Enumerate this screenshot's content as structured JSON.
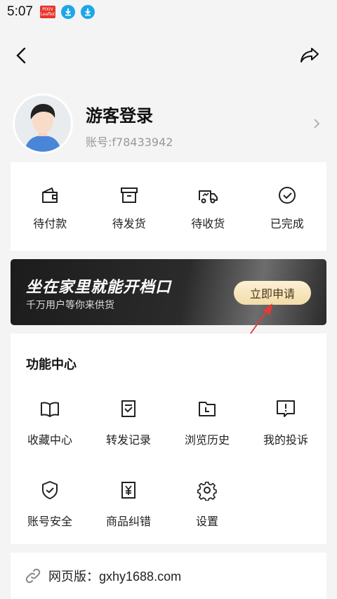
{
  "status_bar": {
    "time": "5:07",
    "badge_line1": "PIXIV",
    "badge_line2": "Leaflet"
  },
  "icons": {
    "back": "chevron-left-icon",
    "share": "share-icon"
  },
  "profile": {
    "name": "游客登录",
    "account": "账号:f78433942"
  },
  "orders": [
    {
      "label": "待付款",
      "icon": "wallet-icon"
    },
    {
      "label": "待发货",
      "icon": "box-icon"
    },
    {
      "label": "待收货",
      "icon": "truck-icon"
    },
    {
      "label": "已完成",
      "icon": "check-circle-icon"
    }
  ],
  "banner": {
    "title": "坐在家里就能开档口",
    "subtitle": "千万用户等你来供货",
    "button": "立即申请"
  },
  "function_center": {
    "title": "功能中心",
    "items": [
      {
        "label": "收藏中心",
        "icon": "book-icon"
      },
      {
        "label": "转发记录",
        "icon": "forward-record-icon"
      },
      {
        "label": "浏览历史",
        "icon": "history-icon"
      },
      {
        "label": "我的投诉",
        "icon": "complaint-icon"
      },
      {
        "label": "账号安全",
        "icon": "shield-icon"
      },
      {
        "label": "商品纠错",
        "icon": "yen-correction-icon"
      },
      {
        "label": "设置",
        "icon": "gear-icon"
      }
    ]
  },
  "web_version": {
    "text": "网页版：gxhy1688.com",
    "icon": "link-icon"
  },
  "colors": {
    "annotation_arrow": "#e53935",
    "banner_button": "#f5e3b5",
    "status_download": "#1ea7e8"
  }
}
